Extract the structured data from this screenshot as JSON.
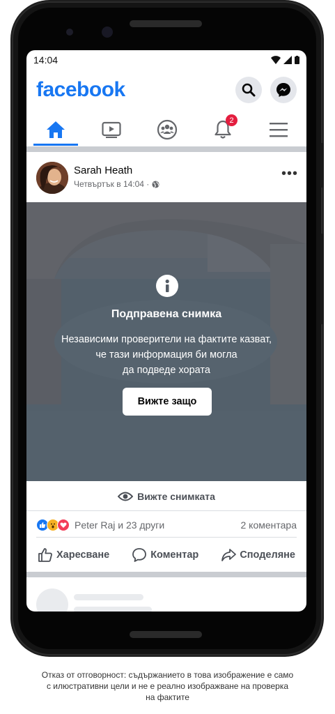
{
  "status_bar": {
    "time": "14:04"
  },
  "header": {
    "logo": "facebook",
    "search_icon": "search-icon",
    "messenger_icon": "messenger-icon"
  },
  "tabs": [
    {
      "name": "home",
      "icon": "home-icon",
      "active": true
    },
    {
      "name": "watch",
      "icon": "video-icon"
    },
    {
      "name": "groups",
      "icon": "groups-icon"
    },
    {
      "name": "notifications",
      "icon": "bell-icon",
      "badge": "2"
    },
    {
      "name": "menu",
      "icon": "menu-icon"
    }
  ],
  "post": {
    "author": "Sarah Heath",
    "time": "Четвъртък в 14:04 ·",
    "privacy_icon": "globe-icon",
    "warning": {
      "title": "Подправена снимка",
      "text_lines": [
        "Независими проверители на фактите казват,",
        "че тази информация би могла",
        "да подведе хората"
      ],
      "button": "Вижте защо"
    },
    "see_photo": "Вижте снимката",
    "reactions_text": "Peter Raj и 23 други",
    "comments_count": "2 коментара",
    "actions": {
      "like": "Харесване",
      "comment": "Коментар",
      "share": "Споделяне"
    }
  },
  "colors": {
    "brand": "#1877f2",
    "badge": "#e41e3f",
    "overlay": "#545c66"
  },
  "disclaimer": {
    "lines": [
      "Отказ от отговорност: съдържанието в това изображение е само",
      "с илюстративни цели и не е реално изображване на проверка",
      "на фактите"
    ]
  }
}
